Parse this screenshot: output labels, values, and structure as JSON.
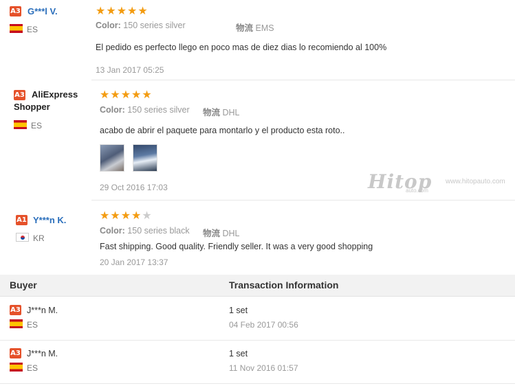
{
  "reviews": [
    {
      "level": "A3",
      "name": "G***l V.",
      "country": "ES",
      "rating": 5,
      "stars_full": "★★★★★",
      "stars_empty": "",
      "color_label": "Color:",
      "color_value": "150 series silver",
      "logistics_label": "物流",
      "logistics_value": "EMS",
      "text": "El pedido es perfecto llego en poco mas de diez dias lo recomiendo al 100%",
      "date": "13 Jan 2017 05:25"
    },
    {
      "level": "A3",
      "name": "AliExpress Shopper",
      "country": "ES",
      "rating": 5,
      "stars_full": "★★★★★",
      "stars_empty": "",
      "color_label": "Color:",
      "color_value": "150 series silver",
      "logistics_label": "物流",
      "logistics_value": "DHL",
      "text": "acabo de abrir el paquete para montarlo y el producto esta roto..",
      "date": "29 Oct 2016 17:03"
    },
    {
      "level": "A1",
      "name": "Y***n K.",
      "country": "KR",
      "rating": 4,
      "stars_full": "★★★★",
      "stars_empty": "★",
      "color_label": "Color:",
      "color_value": "150 series black",
      "logistics_label": "物流",
      "logistics_value": "DHL",
      "text": "Fast shipping. Good quality. Friendly seller. It was a very good shopping",
      "date": "20 Jan 2017 13:37"
    }
  ],
  "watermark": {
    "brand": "Hitop",
    "sub": "auto.com",
    "url": "www.hitopauto.com"
  },
  "table": {
    "headers": [
      "Buyer",
      "Transaction Information"
    ],
    "rows": [
      {
        "level": "A3",
        "name": "J***n M.",
        "country": "ES",
        "quantity": "1 set",
        "date": "04 Feb 2017 00:56"
      },
      {
        "level": "A3",
        "name": "J***n M.",
        "country": "ES",
        "quantity": "1 set",
        "date": "11 Nov 2016 01:57"
      }
    ]
  },
  "colors": {
    "badge": "#e5512a",
    "star": "#f39c12",
    "name_link": "#2a6ebb",
    "header_bg": "#f2f2f2"
  }
}
